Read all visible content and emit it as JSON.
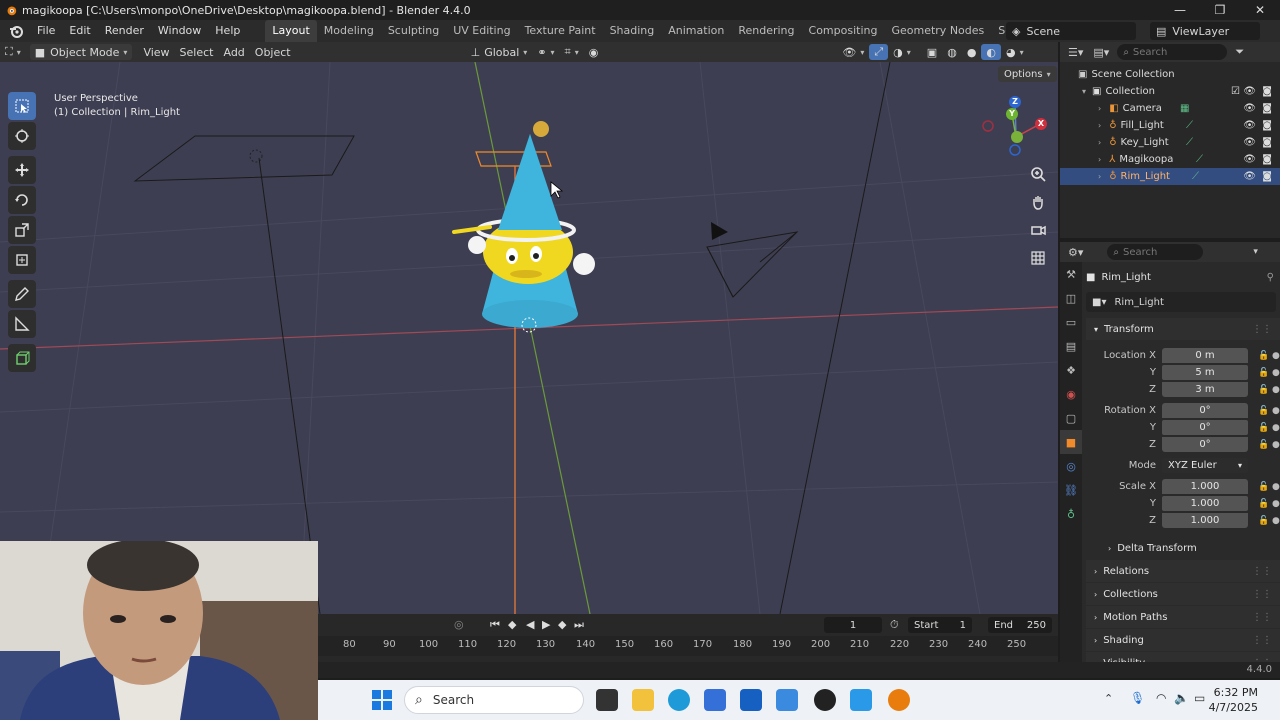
{
  "window": {
    "title": "magikoopa [C:\\Users\\monpo\\OneDrive\\Desktop\\magikoopa.blend] - Blender 4.4.0",
    "minimize": "—",
    "maximize": "❐",
    "close": "✕"
  },
  "menu": [
    "File",
    "Edit",
    "Render",
    "Window",
    "Help"
  ],
  "workspaces": {
    "active": "Layout",
    "tabs": [
      "Modeling",
      "Sculpting",
      "UV Editing",
      "Texture Paint",
      "Shading",
      "Animation",
      "Rendering",
      "Compositing",
      "Geometry Nodes",
      "Scripting"
    ],
    "add": "+"
  },
  "scene": {
    "name": "Scene",
    "view_layer": "ViewLayer"
  },
  "viewport_header": {
    "mode": "Object Mode",
    "menus": [
      "View",
      "Select",
      "Add",
      "Object"
    ],
    "transform_orientation": "Global",
    "options": "Options"
  },
  "viewport": {
    "perspective": "User Perspective",
    "context": "(1) Collection | Rim_Light",
    "gizmo_axes": {
      "z": "Z",
      "y": "Y",
      "x": "X"
    }
  },
  "outliner": {
    "search_placeholder": "Search",
    "root": "Scene Collection",
    "collection": "Collection",
    "items": [
      {
        "name": "Camera",
        "icon": "camera-icon",
        "selected": false
      },
      {
        "name": "Fill_Light",
        "icon": "light-icon",
        "selected": false
      },
      {
        "name": "Key_Light",
        "icon": "light-icon",
        "selected": false
      },
      {
        "name": "Magikoopa",
        "icon": "armature-icon",
        "selected": false
      },
      {
        "name": "Rim_Light",
        "icon": "light-icon",
        "selected": true
      }
    ]
  },
  "properties": {
    "search_placeholder": "Search",
    "object_name": "Rim_Light",
    "datablock_name": "Rim_Light",
    "transform": {
      "title": "Transform",
      "location_label": "Location X",
      "location": [
        "0 m",
        "5 m",
        "3 m"
      ],
      "rotation_label": "Rotation X",
      "rotation": [
        "0°",
        "0°",
        "0°"
      ],
      "mode_label": "Mode",
      "mode": "XYZ Euler",
      "scale_label": "Scale X",
      "scale": [
        "1.000",
        "1.000",
        "1.000"
      ],
      "axis_y": "Y",
      "axis_z": "Z"
    },
    "delta_transform": "Delta Transform",
    "panels": [
      "Relations",
      "Collections",
      "Motion Paths",
      "Shading",
      "Visibility"
    ]
  },
  "timeline": {
    "current_frame": "1",
    "start_label": "Start",
    "start": "1",
    "end_label": "End",
    "end": "250",
    "ticks": [
      "80",
      "90",
      "100",
      "110",
      "120",
      "130",
      "140",
      "150",
      "160",
      "170",
      "180",
      "190",
      "200",
      "210",
      "220",
      "230",
      "240",
      "250"
    ]
  },
  "status": {
    "version": "4.4.0"
  },
  "taskbar": {
    "search": "Search",
    "time": "6:32 PM",
    "date": "4/7/2025"
  },
  "colors": {
    "accent": "#4772b3",
    "selected_row": "#334d80",
    "viewport_bg": "#3e3e52",
    "cone": "#3fb4dc",
    "face": "#f0d820"
  }
}
